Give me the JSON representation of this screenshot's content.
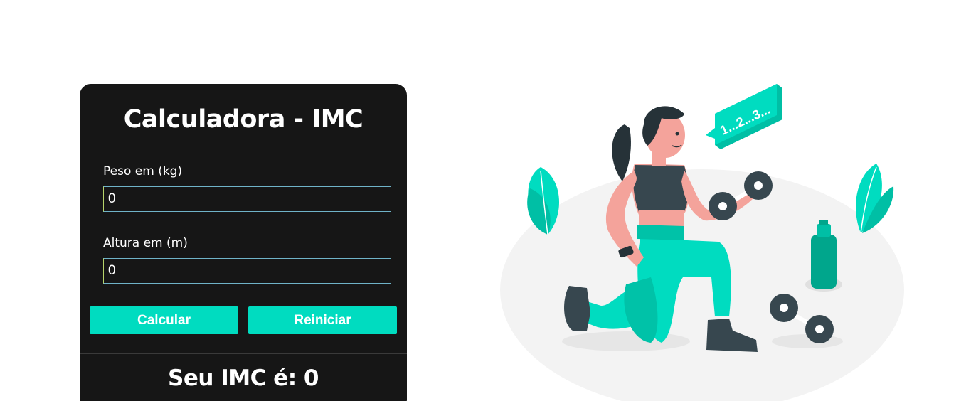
{
  "card": {
    "title": "Calculadora - IMC",
    "weight": {
      "label": "Peso em (kg)",
      "value": "0"
    },
    "height": {
      "label": "Altura em (m)",
      "value": "0"
    },
    "buttons": {
      "calculate": "Calcular",
      "reset": "Reiniciar"
    },
    "result_text": "Seu IMC é: 0"
  },
  "illustration": {
    "speech_bubble_text": "1...2...3...",
    "icon": "fitness-woman-dumbbell-illustration"
  },
  "colors": {
    "card_bg": "#161616",
    "accent": "#00dcc0",
    "illustration_dark": "#37474f",
    "skin": "#f4a39b"
  }
}
